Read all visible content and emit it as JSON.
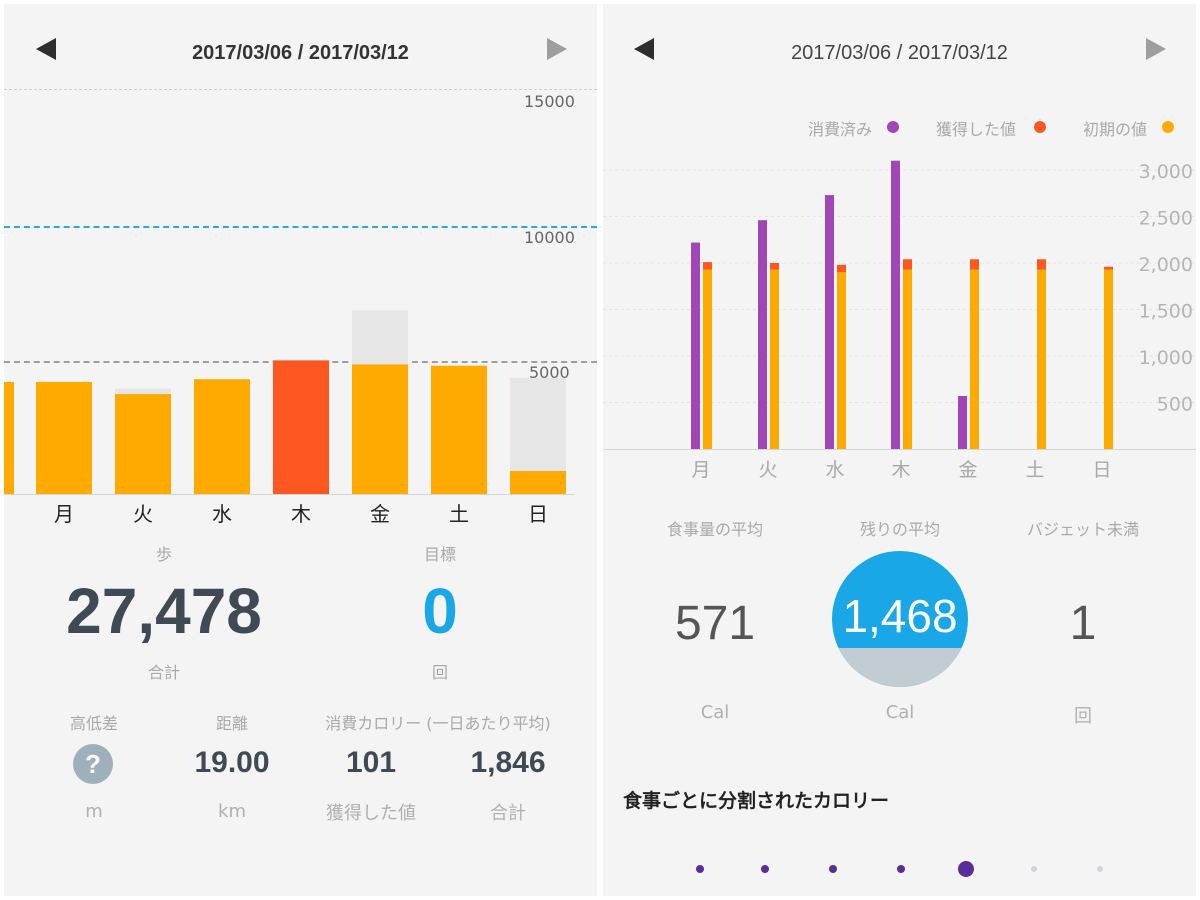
{
  "left": {
    "header": {
      "date_range": "2017/03/06 / 2017/03/12"
    },
    "chart": {
      "y_ticks": [
        "15000",
        "10000",
        "5000"
      ],
      "colors": {
        "bar": "#FFAA00",
        "highlight": "#FF5722",
        "ghost": "#E6E6E6",
        "goal_line": "#29A9E1",
        "grid": "#9E9E9E"
      }
    },
    "stats": {
      "steps_label": "歩",
      "steps_value": "27,478",
      "steps_unit": "合計",
      "goal_label": "目標",
      "goal_value": "0",
      "goal_unit": "回"
    },
    "bottom": {
      "elevation_label": "高低差",
      "elevation_icon": "question-circle-icon",
      "elevation_unit": "m",
      "distance_label": "距離",
      "distance_value": "19.00",
      "distance_unit": "km",
      "calories_label": "消費カロリー (一日あたり平均)",
      "earned_value": "101",
      "earned_unit": "獲得した値",
      "total_value": "1,846",
      "total_unit": "合計"
    }
  },
  "right": {
    "header": {
      "date_range": "2017/03/06 / 2017/03/12"
    },
    "legend": [
      {
        "label": "消費済み",
        "color": "#A046B7"
      },
      {
        "label": "獲得した値",
        "color": "#FF5722"
      },
      {
        "label": "初期の値",
        "color": "#FFAA00"
      }
    ],
    "chart": {
      "y_ticks": [
        "3,000",
        "2,500",
        "2,000",
        "1,500",
        "1,000",
        "500"
      ]
    },
    "stats": {
      "avg_intake_label": "食事量の平均",
      "avg_intake_value": "571",
      "avg_intake_unit": "Cal",
      "avg_remaining_label": "残りの平均",
      "avg_remaining_value": "1,468",
      "avg_remaining_unit": "Cal",
      "avg_remaining_fill_fraction": 0.29,
      "under_budget_label": "バジェット未満",
      "under_budget_value": "1",
      "under_budget_unit": "回"
    },
    "section_title": "食事ごとに分割されたカロリー",
    "pager": {
      "page_count": 7,
      "active_index": 4
    }
  },
  "chart_data": [
    {
      "type": "bar",
      "title": "",
      "categories": [
        "月",
        "火",
        "水",
        "木",
        "金",
        "土",
        "日"
      ],
      "series": [
        {
          "values": [
            4150,
            3700,
            4250,
            4950,
            4800,
            4750,
            850
          ]
        }
      ],
      "goal_line": 10000,
      "ylim": [
        0,
        15000
      ],
      "y_ticks": [
        5000,
        10000,
        15000
      ],
      "grid": true
    },
    {
      "type": "bar",
      "title": "",
      "categories": [
        "月",
        "火",
        "水",
        "木",
        "金",
        "土",
        "日"
      ],
      "series": [
        {
          "name": "消費済み",
          "values": [
            2220,
            2460,
            2730,
            3100,
            570,
            0,
            0
          ]
        },
        {
          "name": "獲得した値",
          "values": [
            80,
            70,
            80,
            110,
            110,
            110,
            30
          ]
        },
        {
          "name": "初期の値",
          "values": [
            1930,
            1930,
            1900,
            1930,
            1930,
            1930,
            1930
          ]
        }
      ],
      "stacked_pairs": [
        "獲得した値",
        "初期の値"
      ],
      "ylim": [
        0,
        3100
      ],
      "y_ticks": [
        500,
        1000,
        1500,
        2000,
        2500,
        3000
      ],
      "grid": true
    }
  ]
}
